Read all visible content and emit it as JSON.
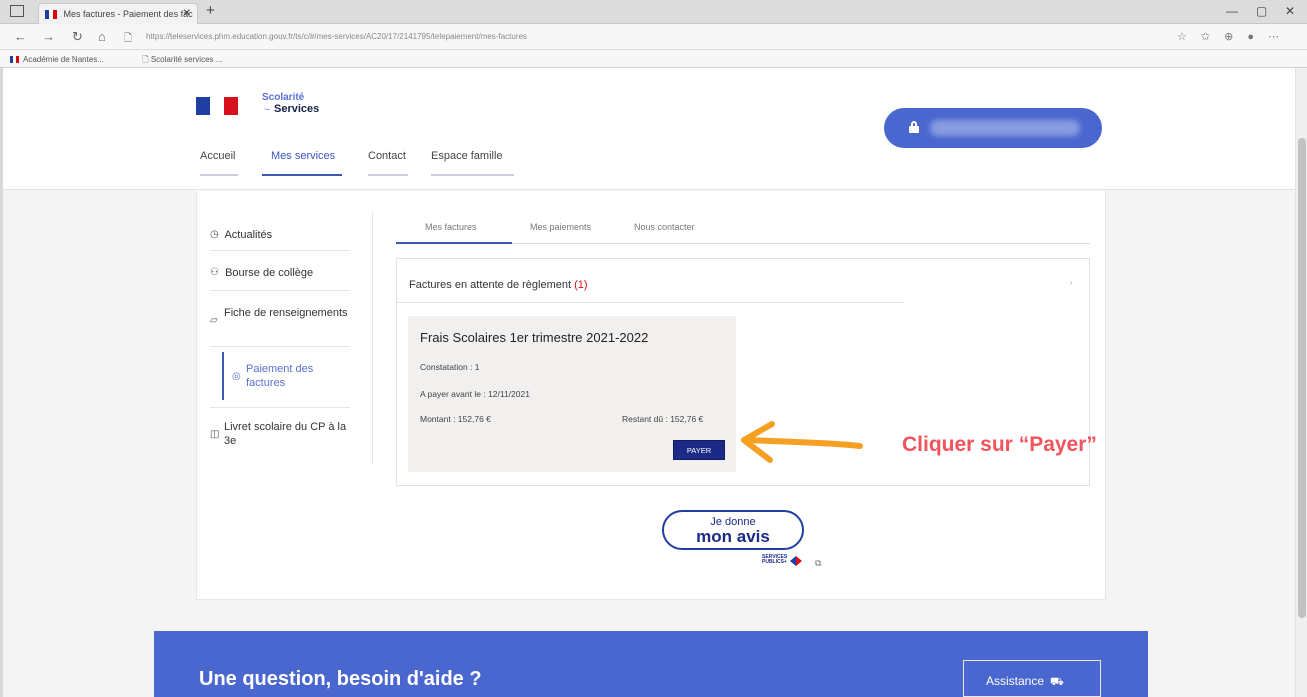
{
  "browser": {
    "tab_title": "Mes factures - Paiement des fac",
    "url": "https://teleservices.phm.education.gouv.fr/ts/c/#/mes-services/AC20/17/2141795/telepaiement/mes-factures",
    "bookmarks": [
      "Académie de Nantes...",
      "Scolarité services ..."
    ]
  },
  "header": {
    "logo_top": "Scolarité",
    "logo_bottom": "Services",
    "nav": [
      "Accueil",
      "Mes services",
      "Contact",
      "Espace famille"
    ],
    "active_nav": "Mes services"
  },
  "sidebar": {
    "items": [
      {
        "icon": "clock-icon",
        "label": "Actualités"
      },
      {
        "icon": "people-icon",
        "label": "Bourse de collège"
      },
      {
        "icon": "form-icon",
        "label": "Fiche de renseignements"
      },
      {
        "icon": "euro-icon",
        "label": "Paiement des factures",
        "active": true
      },
      {
        "icon": "book-icon",
        "label": "Livret scolaire du CP à la 3e"
      }
    ]
  },
  "tabs": [
    "Mes factures",
    "Mes paiements",
    "Nous contacter"
  ],
  "panel": {
    "title": "Factures en attente de règlement",
    "count": "(1)"
  },
  "invoice": {
    "title": "Frais Scolaires 1er trimestre 2021-2022",
    "constatation": "Constatation : 1",
    "due": "A payer avant le : 12/11/2021",
    "amount": "Montant : 152,76 €",
    "remaining": "Restant dû : 152,76 €",
    "pay_label": "PAYER"
  },
  "annotation": "Cliquer sur “Payer”",
  "avis": {
    "line1": "Je donne",
    "line2": "mon avis",
    "logo": "SERVICES PUBLICS+"
  },
  "footer": {
    "title": "Une question, besoin d'aide ?",
    "assist": "Assistance"
  },
  "colors": {
    "brand_blue": "#4a67d0",
    "pay_button": "#1a2a86",
    "annotation": "#f2545b",
    "arrow": "#f5a023"
  }
}
